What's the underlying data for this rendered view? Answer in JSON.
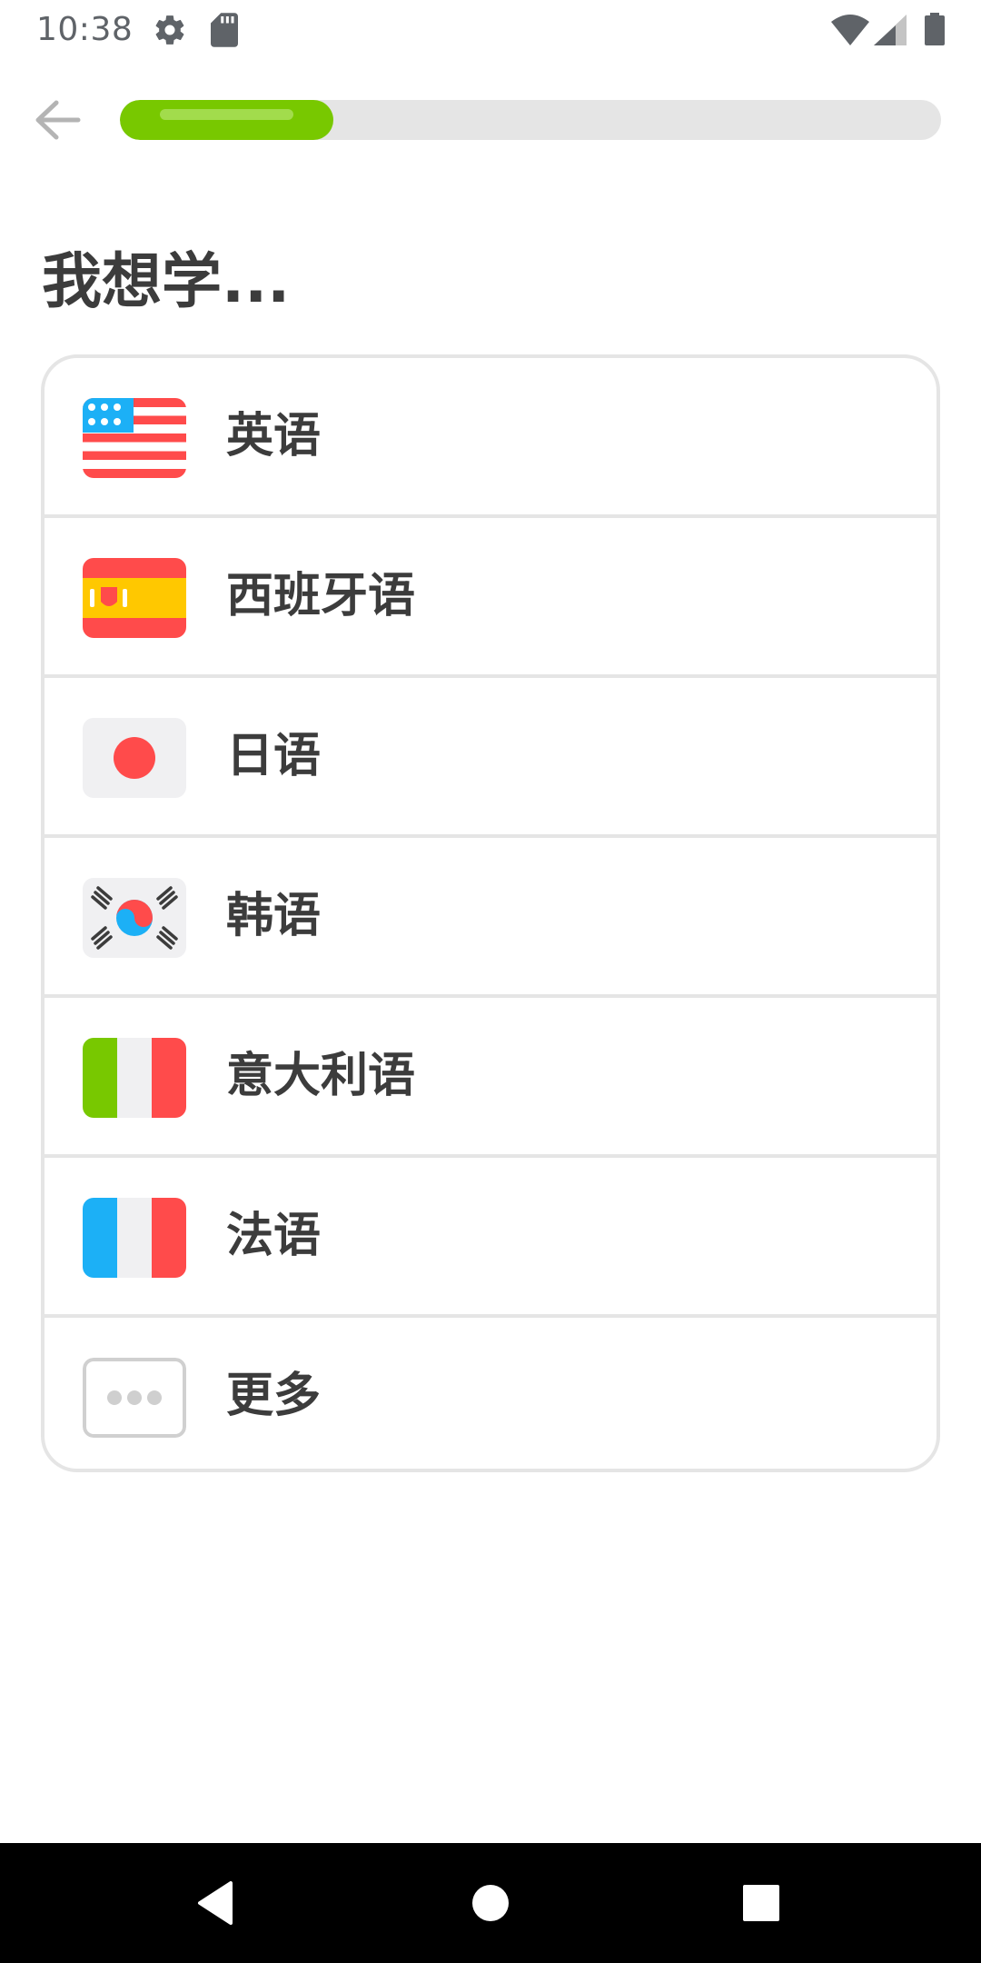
{
  "status_bar": {
    "time": "10:38",
    "icons": [
      "gear-icon",
      "sd-card-icon",
      "wifi-icon",
      "signal-icon",
      "battery-icon"
    ]
  },
  "header": {
    "back_icon": "arrow-left-icon",
    "progress_fraction": 0.26
  },
  "title": "我想学...",
  "courses": [
    {
      "label": "英语",
      "flag": "usa-flag-icon"
    },
    {
      "label": "西班牙语",
      "flag": "spain-flag-icon"
    },
    {
      "label": "日语",
      "flag": "japan-flag-icon"
    },
    {
      "label": "韩语",
      "flag": "korea-flag-icon"
    },
    {
      "label": "意大利语",
      "flag": "italy-flag-icon"
    },
    {
      "label": "法语",
      "flag": "france-flag-icon"
    },
    {
      "label": "更多",
      "flag": "more-dots-icon"
    }
  ],
  "nav_bar": {
    "icons": [
      "nav-back-icon",
      "nav-home-icon",
      "nav-recent-icon"
    ]
  },
  "colors": {
    "accent_green": "#78c800",
    "track_gray": "#e5e5e5",
    "text_dark": "#3c3c3c",
    "flag_red": "#ff4b4b",
    "flag_yellow": "#ffc800",
    "flag_blue": "#1cb0f6",
    "flag_white": "#f0f0f2"
  }
}
